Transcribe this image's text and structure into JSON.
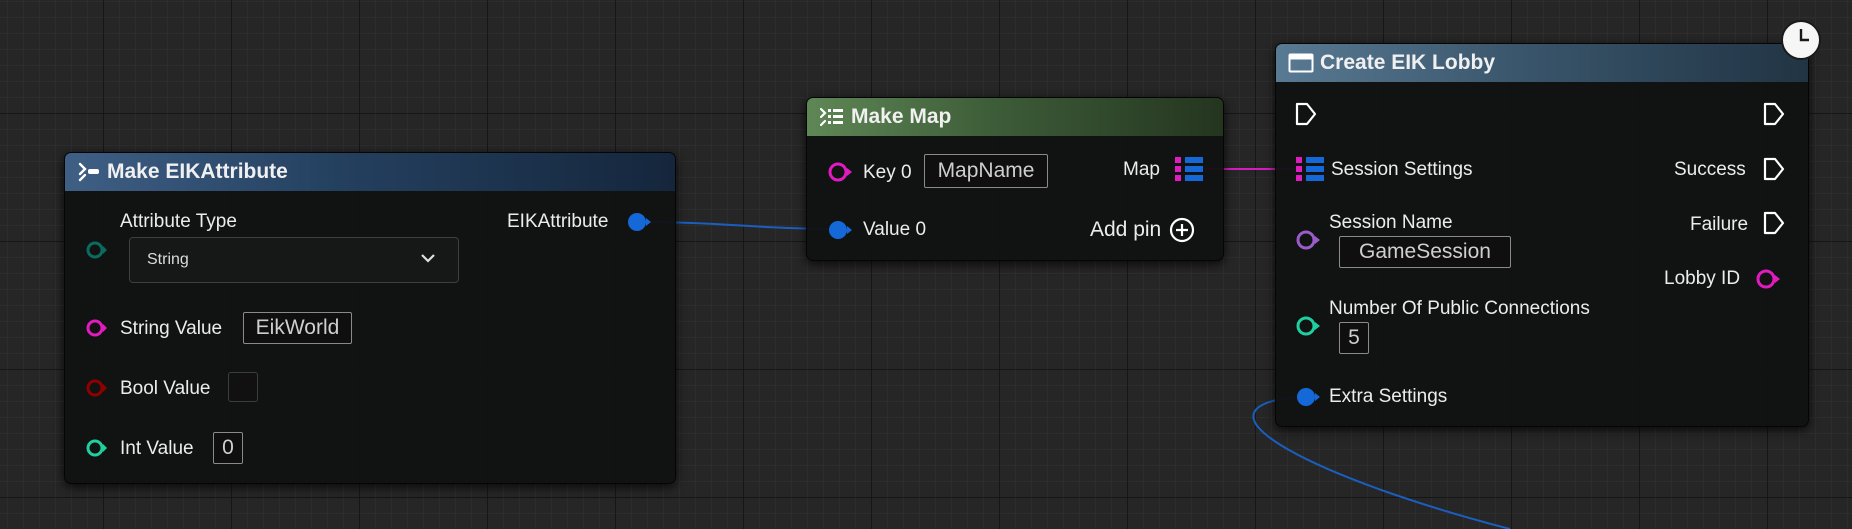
{
  "nodes": {
    "make_attribute": {
      "title": "Make EIKAttribute",
      "attribute_type_label": "Attribute Type",
      "attribute_type_value": "String",
      "output_label": "EIKAttribute",
      "string_value_label": "String Value",
      "string_value": "EikWorld",
      "bool_value_label": "Bool Value",
      "int_value_label": "Int Value",
      "int_value": "0"
    },
    "make_map": {
      "title": "Make Map",
      "key_label": "Key 0",
      "key_value": "MapName",
      "value_label": "Value 0",
      "output_label": "Map",
      "add_pin_label": "Add pin"
    },
    "create_lobby": {
      "title": "Create EIK Lobby",
      "session_settings_label": "Session Settings",
      "session_name_label": "Session Name",
      "session_name_value": "GameSession",
      "public_connections_label": "Number Of Public Connections",
      "public_connections_value": "5",
      "extra_settings_label": "Extra Settings",
      "success_label": "Success",
      "failure_label": "Failure",
      "lobby_id_label": "Lobby ID"
    }
  },
  "colors": {
    "struct_pin": "#1468d8",
    "string_pin": "#e21bc1",
    "name_pin": "#9b5bc8",
    "int_pin": "#1fcfa0",
    "bool_pin": "#8f0000",
    "enum_pin": "#0b6b5e",
    "map_key_icon": "#e21bc1",
    "map_value_icon": "#1468d8",
    "exec_pin": "#ffffff"
  },
  "icons": {
    "make_struct": "make-struct-icon",
    "make_map": "make-map-icon",
    "function": "function-node-icon",
    "latent": "clock-icon",
    "add": "add-circle-icon",
    "dropdown": "chevron-down-icon"
  }
}
